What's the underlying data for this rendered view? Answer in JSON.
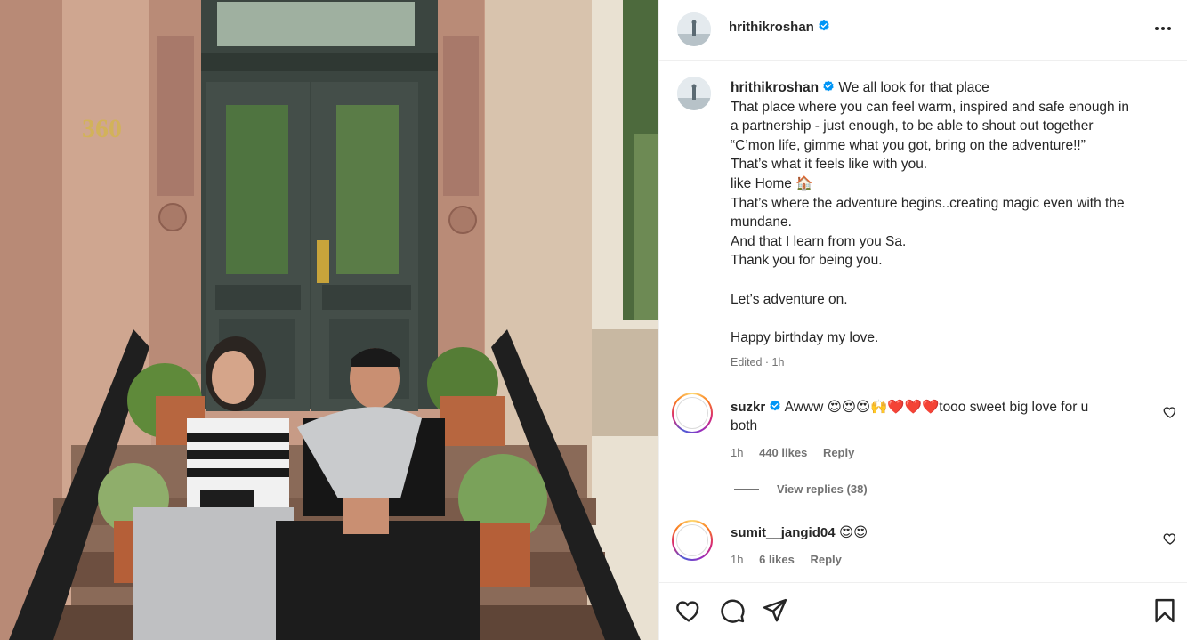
{
  "post": {
    "username": "hrithikroshan",
    "verified": true,
    "more_icon": "more-horizontal-icon"
  },
  "caption": {
    "username": "hrithikroshan",
    "lines": [
      "We all look for that place",
      "That place where you can feel warm, inspired and safe enough in",
      "a partnership - just enough, to be able to shout out together",
      "“C’mon life, gimme what you got, bring on the adventure!!”",
      "That’s what it feels like with you.",
      "like Home 🏠",
      "That’s where the adventure begins..creating magic even with the",
      "mundane.",
      "And that I learn from you Sa.",
      "Thank you for being you.",
      "",
      "Let’s adventure on.",
      "",
      "Happy birthday my love."
    ],
    "meta": "Edited · 1h"
  },
  "comments": [
    {
      "username": "suzkr",
      "verified": true,
      "text_line1": "Awww 😍😍😍🙌❤️❤️❤️tooo sweet big love for u",
      "text_line2": "both",
      "time": "1h",
      "likes": "440 likes",
      "reply": "Reply"
    },
    {
      "username": "sumit__jangid04",
      "verified": false,
      "text_line1": "😍😍",
      "time": "1h",
      "likes": "6 likes",
      "reply": "Reply"
    }
  ],
  "view_replies": "View replies (38)",
  "actions": {
    "like": "heart-icon",
    "comment": "comment-icon",
    "share": "share-icon",
    "save": "bookmark-icon"
  },
  "photo": {
    "house_number": "360"
  },
  "colors": {
    "verified": "#0095f6",
    "text": "#262626",
    "muted": "#737373",
    "divider": "#efefef"
  }
}
